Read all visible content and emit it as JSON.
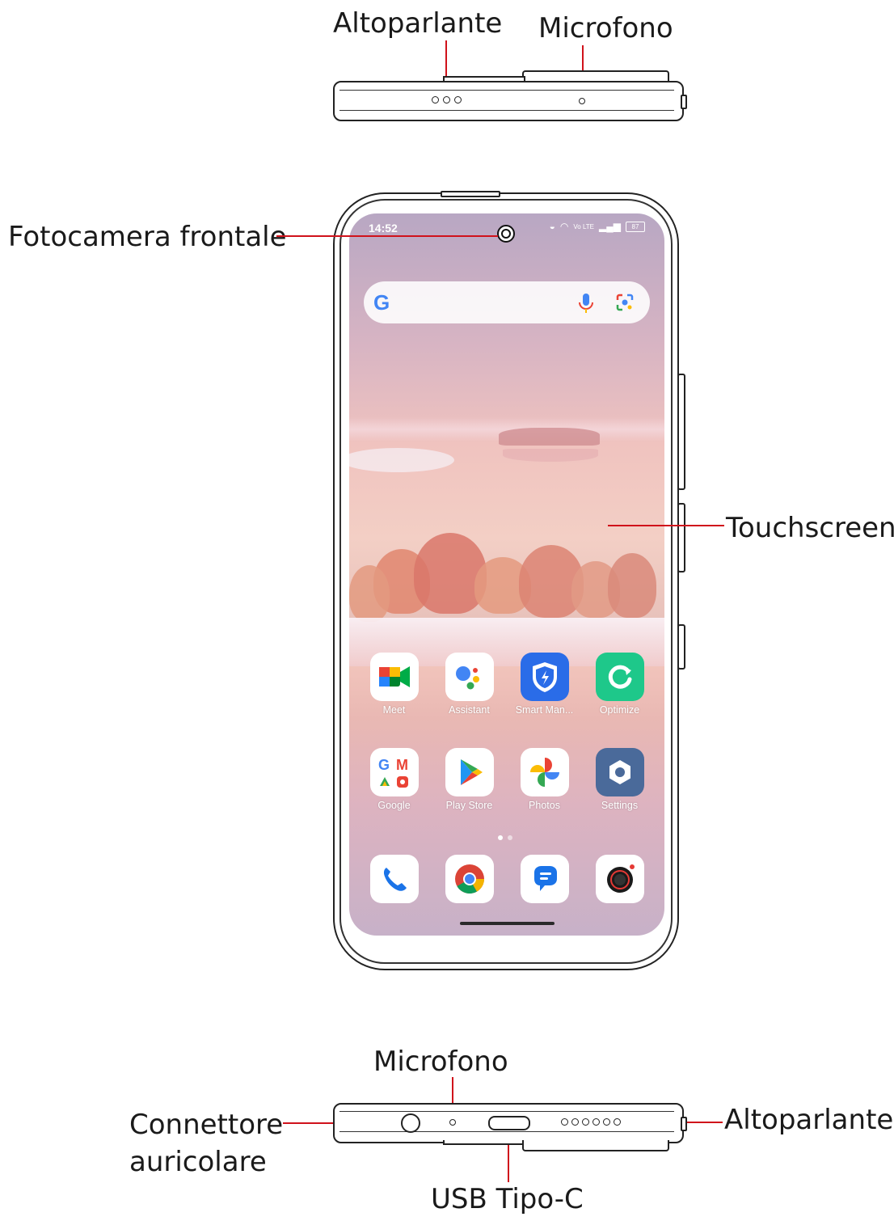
{
  "top_view": {
    "speaker_label": "Altoparlante",
    "mic_label": "Microfono"
  },
  "front_view": {
    "front_camera_label": "Fotocamera frontale",
    "touchscreen_label": "Touchscreen",
    "screen": {
      "status_time": "14:52",
      "status_network": "Vo LTE",
      "status_battery": "87",
      "apps_row1": [
        {
          "name": "Meet",
          "icon": "meet-icon"
        },
        {
          "name": "Assistant",
          "icon": "assistant-icon"
        },
        {
          "name": "Smart Man...",
          "icon": "shield-icon"
        },
        {
          "name": "Optimize",
          "icon": "optimize-icon"
        }
      ],
      "apps_row2": [
        {
          "name": "Google",
          "icon": "google-folder-icon"
        },
        {
          "name": "Play Store",
          "icon": "play-store-icon"
        },
        {
          "name": "Photos",
          "icon": "photos-icon"
        },
        {
          "name": "Settings",
          "icon": "gear-icon"
        }
      ],
      "dock": [
        {
          "icon": "phone-icon"
        },
        {
          "icon": "chrome-icon"
        },
        {
          "icon": "messages-icon"
        },
        {
          "icon": "camera-icon"
        }
      ]
    }
  },
  "bottom_view": {
    "mic_label": "Microfono",
    "headphone_label_line1": "Connettore",
    "headphone_label_line2": "auricolare",
    "speaker_label": "Altoparlante",
    "usb_label": "USB Tipo-C"
  },
  "colors": {
    "callout_line": "#d0121b",
    "outline": "#222222"
  }
}
